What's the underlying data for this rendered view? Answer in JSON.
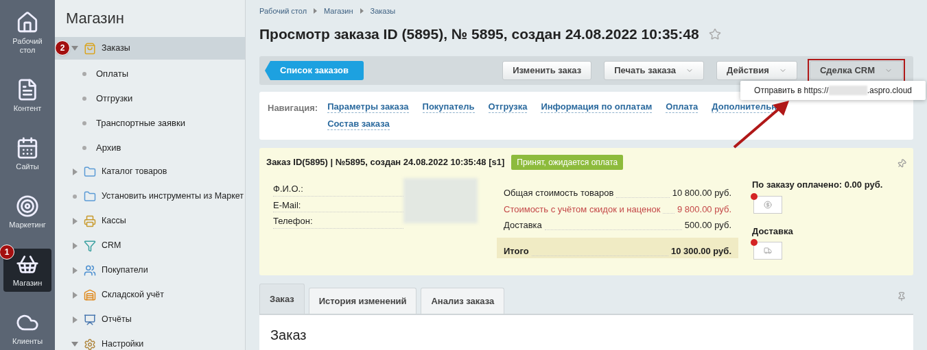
{
  "left_bar": [
    {
      "kind": "home",
      "label": "Рабочий стол",
      "selected": false
    },
    {
      "kind": "content",
      "label": "Контент",
      "selected": false
    },
    {
      "kind": "sites",
      "label": "Сайты",
      "selected": false
    },
    {
      "kind": "marketing",
      "label": "Маркетинг",
      "selected": false
    },
    {
      "kind": "shop",
      "label": "Магазин",
      "selected": true,
      "marker": "1"
    },
    {
      "kind": "clients",
      "label": "Клиенты",
      "selected": false
    }
  ],
  "menu": {
    "title": "Магазин",
    "items": [
      {
        "kind": "bag",
        "label": "Заказы",
        "expanded": true,
        "selected": true,
        "marker": "2",
        "children": [
          {
            "label": "Оплаты"
          },
          {
            "label": "Отгрузки"
          },
          {
            "label": "Транспортные заявки"
          },
          {
            "label": "Архив"
          }
        ]
      },
      {
        "kind": "folder",
        "label": "Каталог товаров",
        "expanded": false,
        "selected": false
      },
      {
        "kind": "folder_leaf",
        "label": "Установить инструменты из Маркет",
        "selected": false
      },
      {
        "kind": "register",
        "label": "Кассы",
        "expanded": false,
        "selected": false
      },
      {
        "kind": "funnel",
        "label": "CRM",
        "expanded": false,
        "selected": false
      },
      {
        "kind": "users",
        "label": "Покупатели",
        "expanded": false,
        "selected": false
      },
      {
        "kind": "warehouse",
        "label": "Складской учёт",
        "expanded": false,
        "selected": false
      },
      {
        "kind": "report",
        "label": "Отчёты",
        "expanded": false,
        "selected": false
      },
      {
        "kind": "settings",
        "label": "Настройки",
        "expanded": true,
        "selected": false
      }
    ]
  },
  "breadcrumbs": [
    "Рабочий стол",
    "Магазин",
    "Заказы"
  ],
  "title": "Просмотр заказа ID (5895), № 5895, создан 24.08.2022 10:35:48",
  "toolbar": {
    "back": "Список заказов",
    "buttons": [
      {
        "label": "Изменить заказ",
        "dropdown": false,
        "highlighted": false
      },
      {
        "label": "Печать заказа",
        "dropdown": true,
        "highlighted": false
      },
      {
        "label": "Действия",
        "dropdown": true,
        "highlighted": false
      },
      {
        "label": "Сделка CRM",
        "dropdown": true,
        "highlighted": true
      }
    ]
  },
  "popup": {
    "prefix": "Отправить в https://",
    "suffix": ".aspro.cloud"
  },
  "navigation": {
    "label": "Навигация:",
    "links": [
      "Параметры заказа",
      "Покупатель",
      "Отгрузка",
      "Информация по оплатам",
      "Оплата",
      "Дополнительн",
      "Состав заказа"
    ]
  },
  "order": {
    "heading": "Заказ ID(5895) | №5895, создан 24.08.2022 10:35:48 [s1]",
    "status": {
      "label": "Принят, ожидается оплата",
      "color": "#8dbb3c"
    },
    "fields": [
      "Ф.И.О.:",
      "E-Mail:",
      "Телефон:"
    ],
    "totals": [
      {
        "kind": "normal",
        "label": "Общая стоимость товаров",
        "value": "10 800.00 руб."
      },
      {
        "kind": "discount",
        "label": "Стоимость с учётом скидок и наценок",
        "value": "9 800.00 руб."
      },
      {
        "kind": "normal",
        "label": "Доставка",
        "value": "500.00 руб."
      },
      {
        "kind": "total",
        "label": "Итого",
        "value": "10 300.00 руб."
      }
    ],
    "paid_label": "По заказу оплачено: 0.00 руб.",
    "payment_done": false,
    "delivery_label": "Доставка",
    "delivery_done": false
  },
  "tabs": [
    {
      "label": "Заказ",
      "selected": true
    },
    {
      "label": "История изменений",
      "selected": false
    },
    {
      "label": "Анализ заказа",
      "selected": false
    }
  ],
  "section_title": "Заказ"
}
